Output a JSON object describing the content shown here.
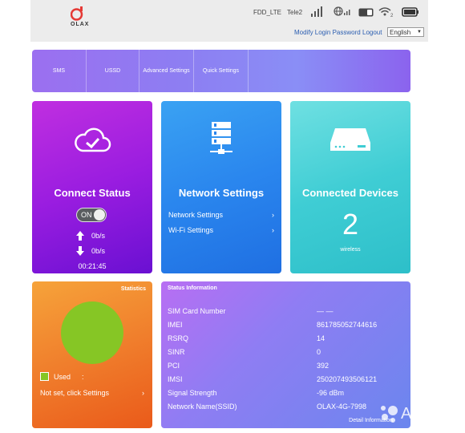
{
  "header": {
    "logo_text": "OLAX",
    "network_type": "FDD_LTE",
    "operator": "Tele2",
    "modify_login_password": "Modify Login Password",
    "logout": "Logout",
    "language": "English"
  },
  "tabs": [
    "SMS",
    "USSD",
    "Advanced Settings",
    "Quick Settings"
  ],
  "connect_status": {
    "title": "Connect Status",
    "toggle_label": "ON",
    "upload": "0b/s",
    "download": "0b/s",
    "time": "00:21:45"
  },
  "network_settings": {
    "title": "Network Settings",
    "links": [
      "Network Settings",
      "Wi-Fi Settings"
    ]
  },
  "connected_devices": {
    "title": "Connected Devices",
    "count": "2",
    "sub": "wireless"
  },
  "statistics": {
    "title": "Statistics",
    "legend_label": "Used",
    "legend_colon": ":",
    "not_set": "Not set, click Settings",
    "pie_color": "#86c625"
  },
  "status_info": {
    "title": "Status Information",
    "rows": [
      {
        "key": "SIM Card Number",
        "value": "— —"
      },
      {
        "key": "IMEI",
        "value": "861785052744616"
      },
      {
        "key": "RSRQ",
        "value": "14"
      },
      {
        "key": "SINR",
        "value": "0"
      },
      {
        "key": "PCI",
        "value": "392"
      },
      {
        "key": "IMSI",
        "value": "250207493506121"
      },
      {
        "key": "Signal Strength",
        "value": "-96 dBm"
      },
      {
        "key": "Network Name(SSID)",
        "value": "OLAX-4G-7998"
      }
    ],
    "detail_link": "Detail Information"
  },
  "watermark": "Avito"
}
